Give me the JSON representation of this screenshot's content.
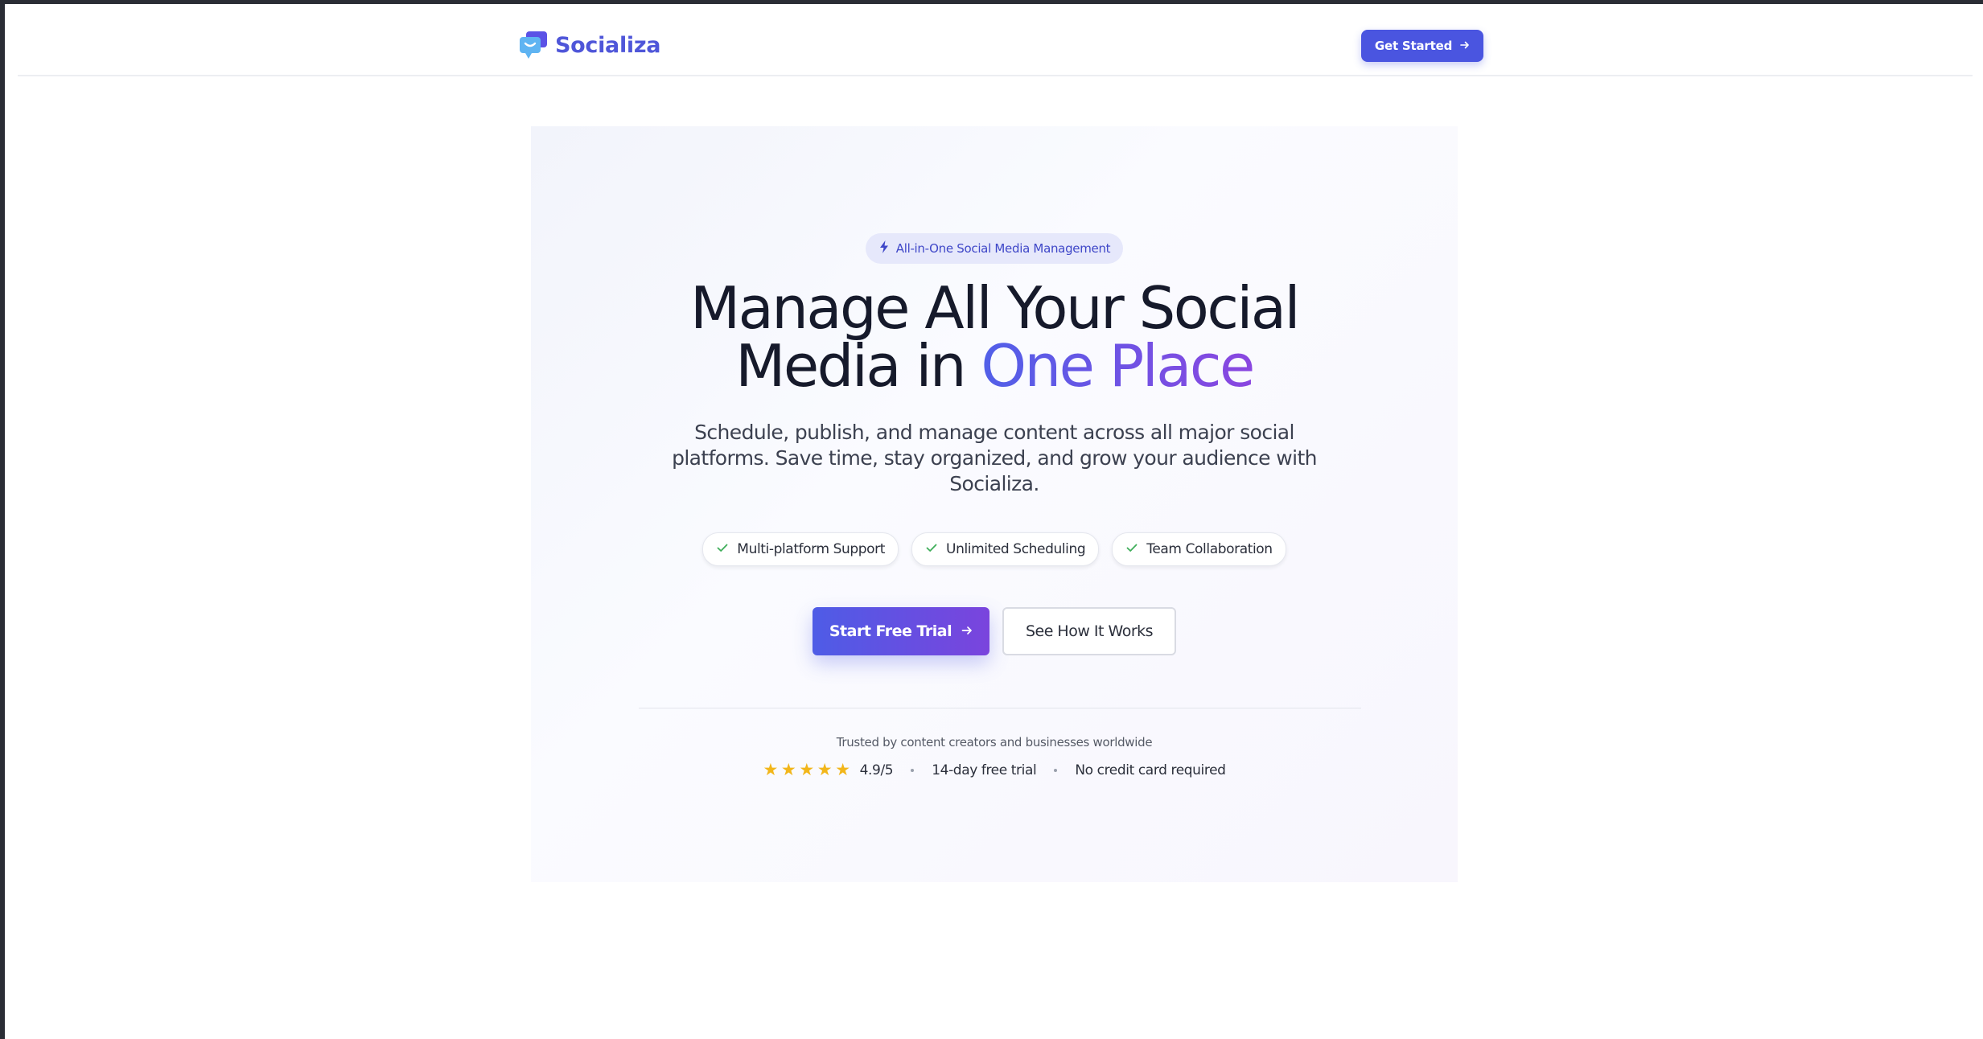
{
  "header": {
    "brand": "Socializa",
    "cta_label": "Get Started"
  },
  "hero": {
    "badge_text": "All-in-One Social Media Management",
    "headline_line1": "Manage All Your Social",
    "headline_line2_prefix": "Media in ",
    "headline_accent": "One Place",
    "subtext": "Schedule, publish, and manage content across all major social platforms. Save time, stay organized, and grow your audience with Socializa.",
    "features": [
      {
        "label": "Multi-platform Support"
      },
      {
        "label": "Unlimited Scheduling"
      },
      {
        "label": "Team Collaboration"
      }
    ],
    "primary_cta": "Start Free Trial",
    "secondary_cta": "See How It Works",
    "trusted_text": "Trusted by content creators and businesses worldwide",
    "rating": "4.9/5",
    "rating_stars": 5,
    "trial_text": "14-day free trial",
    "no_card_text": "No credit card required"
  },
  "icons": {
    "logo": "chat-bubbles-icon",
    "badge": "lightning-icon",
    "feature": "check-icon",
    "arrow": "arrow-right-icon",
    "star": "star-icon"
  },
  "colors": {
    "brand": "#4f56d9",
    "primary_button": "#4a55e0",
    "gradient_start": "#5160e8",
    "gradient_end": "#8a46e0",
    "check": "#3fae5a",
    "star": "#f2b61a"
  }
}
